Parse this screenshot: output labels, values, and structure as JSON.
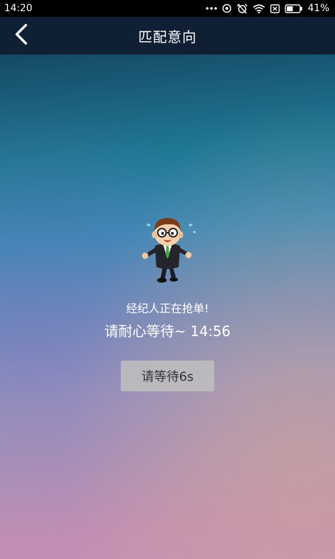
{
  "status_bar": {
    "time": "14:20",
    "battery_percent": "41%",
    "icons": [
      "more-dots-icon",
      "data-saver-icon",
      "alarm-off-icon",
      "wifi-icon",
      "no-sim-icon",
      "battery-icon"
    ]
  },
  "nav": {
    "title": "匹配意向",
    "back_icon": "chevron-left-icon"
  },
  "main": {
    "message_1": "经纪人正在抢单!",
    "message_2": "请耐心等待~ 14:56",
    "wait_button_label": "请等待6s"
  },
  "colors": {
    "nav_bg": "#0f2035",
    "button_bg": "#bebebe",
    "text": "#ffffff"
  }
}
